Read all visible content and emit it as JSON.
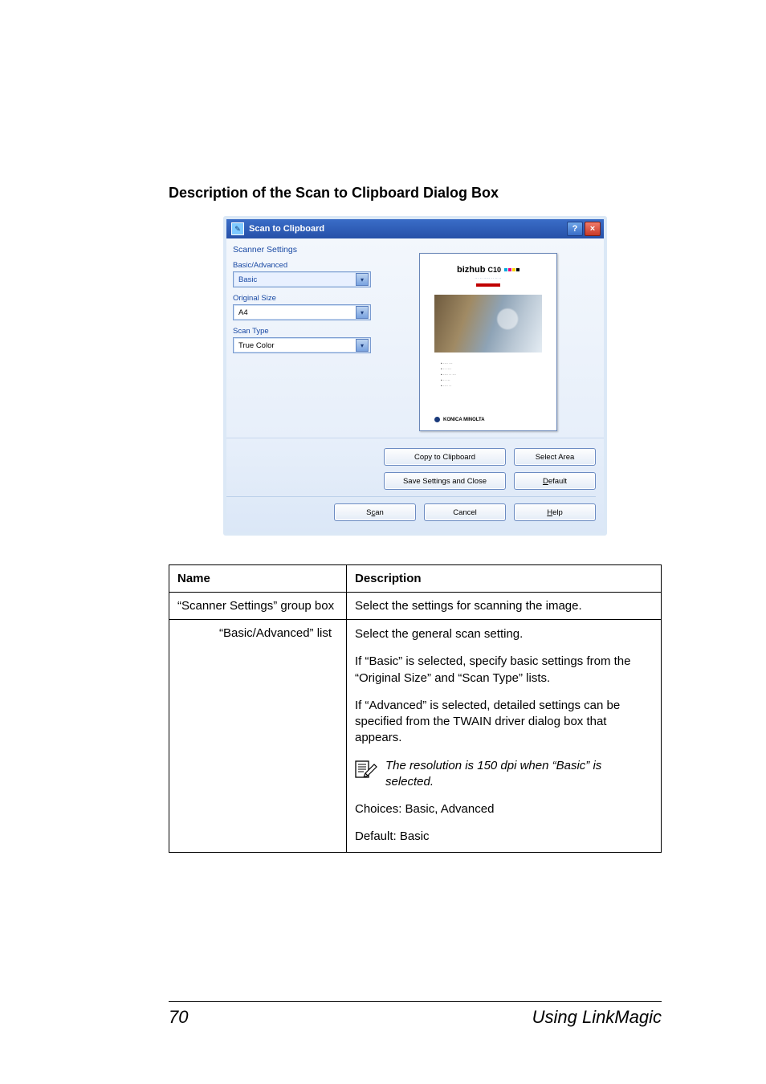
{
  "heading": "Description of the Scan to Clipboard Dialog Box",
  "dialog": {
    "title": "Scan to Clipboard",
    "group_label": "Scanner Settings",
    "fields": {
      "basic_advanced": {
        "label": "Basic/Advanced",
        "value": "Basic"
      },
      "original_size": {
        "label": "Original Size",
        "value": "A4"
      },
      "scan_type": {
        "label": "Scan Type",
        "value": "True Color"
      }
    },
    "preview": {
      "brand_main": "bizhub",
      "brand_sub": "C10",
      "footer_brand": "KONICA MINOLTA"
    },
    "buttons": {
      "copy_to_clipboard": "Copy to Clipboard",
      "select_area": "Select Area",
      "save_settings_and_close": "Save Settings and Close",
      "default": "Default",
      "scan_pre": "S",
      "scan_mn": "c",
      "scan_post": "an",
      "cancel": "Cancel",
      "help_pre": "",
      "help_mn": "H",
      "help_post": "elp",
      "default_pre": "",
      "default_mn": "D",
      "default_post": "efault"
    }
  },
  "table": {
    "header_name": "Name",
    "header_desc": "Description",
    "row_group": {
      "name": "“Scanner Settings” group box",
      "desc": "Select the settings for scanning the image."
    },
    "row_basic": {
      "name": "“Basic/Advanced” list",
      "p1": "Select the general scan setting.",
      "p2": "If “Basic” is selected, specify basic settings from the “Original Size” and “Scan Type” lists.",
      "p3": "If “Advanced” is selected, detailed settings can be specified from the TWAIN driver dialog box that appears.",
      "note": "The resolution is 150 dpi when “Basic” is selected.",
      "p4": "Choices: Basic, Advanced",
      "p5": "Default: Basic"
    }
  },
  "footer": {
    "page_number": "70",
    "section_title": "Using LinkMagic"
  }
}
